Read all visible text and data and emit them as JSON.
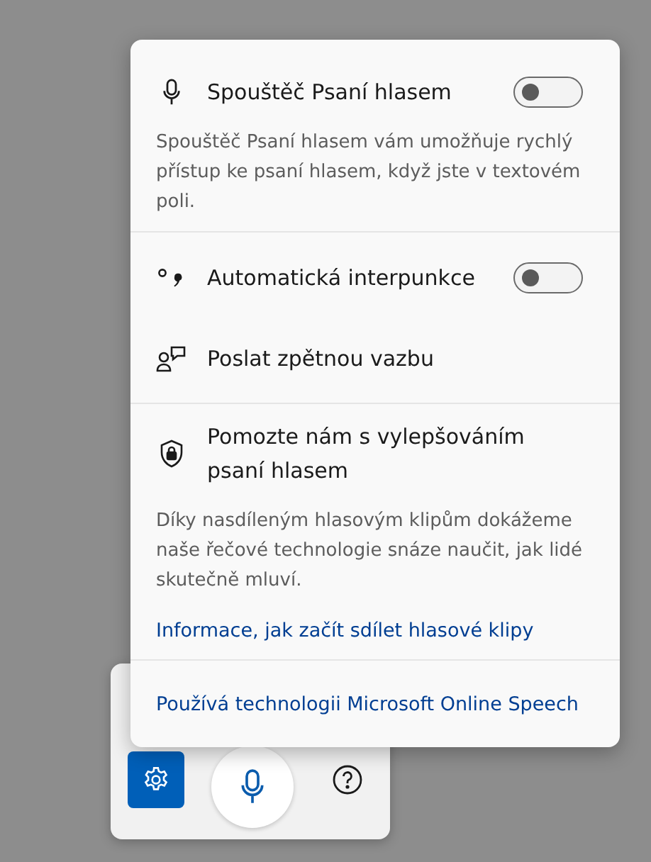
{
  "voice_typing_launcher": {
    "label": "Spouštěč Psaní hlasem",
    "on": false,
    "description": "Spouštěč Psaní hlasem vám umožňuje rychlý přístup ke psaní hlasem, když jste v textovém poli."
  },
  "auto_punctuation": {
    "label": "Automatická interpunkce",
    "on": false
  },
  "feedback": {
    "label": "Poslat zpětnou vazbu"
  },
  "privacy": {
    "title": "Pomozte nám s vylepšováním psaní hlasem",
    "description": "Díky nasdíleným hlasovým klipům dokážeme naše řečové technologie snáze naučit, jak lidé skutečně mluví.",
    "link": "Informace, jak začít sdílet hlasové klipy"
  },
  "footer_link": "Používá technologii Microsoft Online Speech",
  "toolbar": {
    "buttons": [
      {
        "kind": "settings",
        "selected": true
      },
      {
        "kind": "microphone",
        "selected": false
      },
      {
        "kind": "help",
        "selected": false
      }
    ]
  }
}
